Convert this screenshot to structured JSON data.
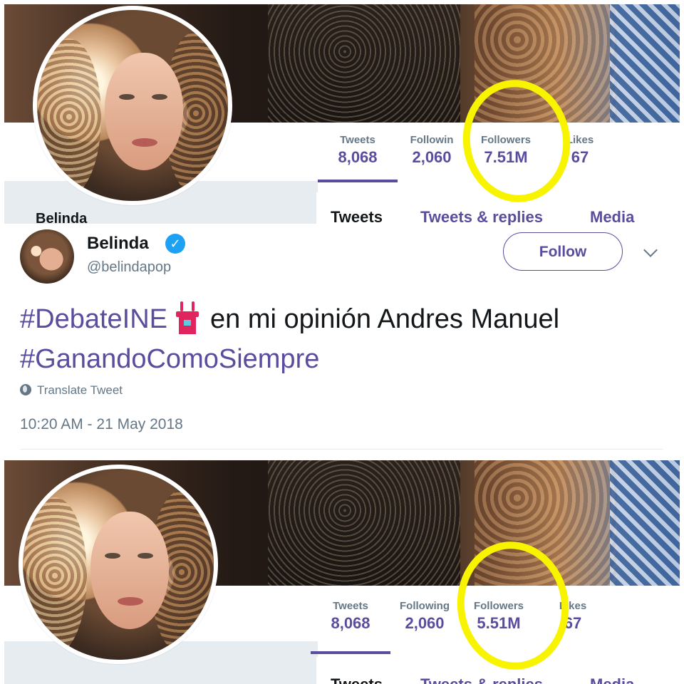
{
  "top_profile": {
    "stats": [
      {
        "label": "Tweets",
        "value": "8,068"
      },
      {
        "label": "Followin",
        "value": "2,060"
      },
      {
        "label": "Followers",
        "value": "7.51M"
      },
      {
        "label": "Likes",
        "value": "67"
      }
    ],
    "tabs": [
      "Tweets",
      "Tweets & replies",
      "Media"
    ],
    "name_peek": "Belinda"
  },
  "tweet": {
    "display_name": "Belinda",
    "handle": "@belindapop",
    "follow_label": "Follow",
    "hashtag1": "#DebateINE",
    "text_middle": "en mi opinión Andres Manuel",
    "hashtag2": "#GanandoComoSiempre",
    "translate_label": "Translate Tweet",
    "timestamp": "10:20 AM - 21 May 2018"
  },
  "bottom_profile": {
    "stats": [
      {
        "label": "Tweets",
        "value": "8,068"
      },
      {
        "label": "Following",
        "value": "2,060"
      },
      {
        "label": "Followers",
        "value": "5.51M"
      },
      {
        "label": "Likes",
        "value": "67"
      }
    ],
    "tabs": [
      "Tweets",
      "Tweets & replies",
      "Media"
    ]
  },
  "colors": {
    "accent": "#5b4c9d",
    "highlight": "#f8f400",
    "verified": "#1da1f2",
    "muted": "#657786"
  },
  "icons": [
    "verified-badge-icon",
    "chevron-down-icon",
    "globe-icon",
    "podium-emoji-icon"
  ]
}
